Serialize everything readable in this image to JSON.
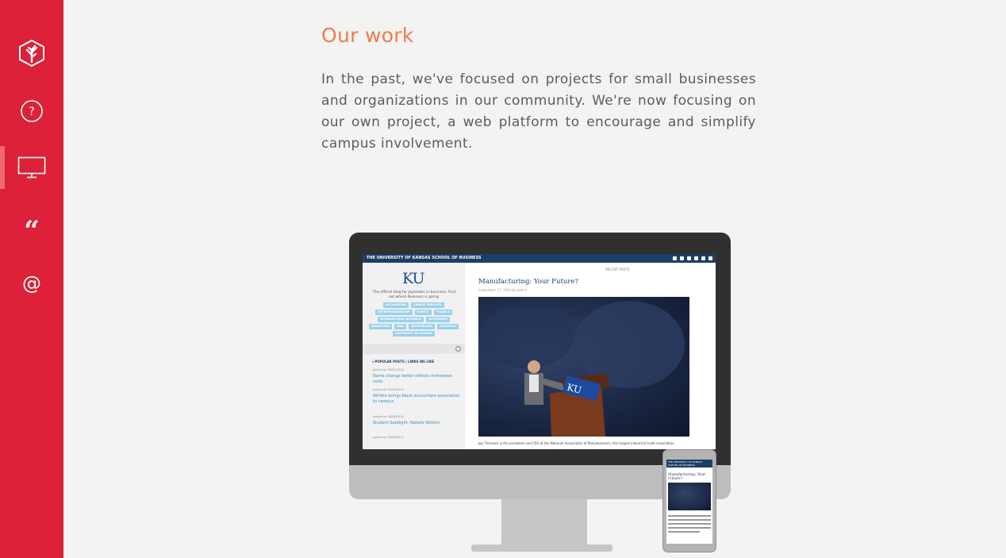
{
  "sidebar": {
    "items": [
      {
        "icon": "leaf-hexagon-icon",
        "active": false
      },
      {
        "icon": "question-icon",
        "active": false
      },
      {
        "icon": "monitor-icon",
        "active": true
      },
      {
        "icon": "quote-icon",
        "active": false
      },
      {
        "icon": "at-icon",
        "active": false
      }
    ],
    "at_glyph": "@",
    "quote_glyph": "“",
    "question_glyph": "?"
  },
  "colors": {
    "sidebar": "#dc2139",
    "heading": "#ef7b4f",
    "ku_navy": "#1c3f66",
    "ku_blue": "#3a8dc5",
    "tag": "#9ad0ec"
  },
  "main": {
    "title": "Our work",
    "intro": "In the past, we've focused on projects for small businesses and organizations in our community. We're now focusing on our own project, a web platform to encourage and simplify campus involvement."
  },
  "showcase": {
    "site_header": "THE UNIVERSITY OF KANSAS SCHOOL OF BUSINESS",
    "logo": "KU",
    "tagline": "The official blog for Jayhawks in business. Find out where Business is going.",
    "tags_row1": [
      "ACCOUNTING",
      "CAREER SERVICES"
    ],
    "tags_row2": [
      "ENTREPRENEURSHIP",
      "EVENTS",
      "FINANCE"
    ],
    "tags_row3": [
      "INTERNATIONAL BUSINESS",
      "INTERNSHIP"
    ],
    "tags_row4": [
      "MARKETING",
      "MBA",
      "NETWORKING",
      "RESEARCH"
    ],
    "tags_row5": [
      "UNIVERSITY OF KANSAS"
    ],
    "popular_heading": "▾ POPULAR POSTS | LINKS WE LIKE",
    "posts": [
      {
        "meta": "posted on 09/30/2014",
        "title": "Name change better reflects hometown roots"
      },
      {
        "meta": "posted on 07/02/2014",
        "title": "Athlete brings black accountant association to campus"
      },
      {
        "meta": "posted on 06/06/2014",
        "title": "Student Spotlight: Natalie Wilkins"
      },
      {
        "meta": "posted on 06/06/2014",
        "title": ""
      }
    ],
    "recent_label": "RECENT POSTS",
    "post_title": "Manufacturing: Your Future?",
    "post_date": "September 17, 2014 by admin",
    "caption": "Jay Timmons is the president and CEO of the National Association of Manufacturers, the largest industrial trade association.",
    "phone_header": "THE UNIVERSITY OF KANSAS SCHOOL OF BUSINESS",
    "phone_title": "Manufacturing: Your Future?"
  }
}
